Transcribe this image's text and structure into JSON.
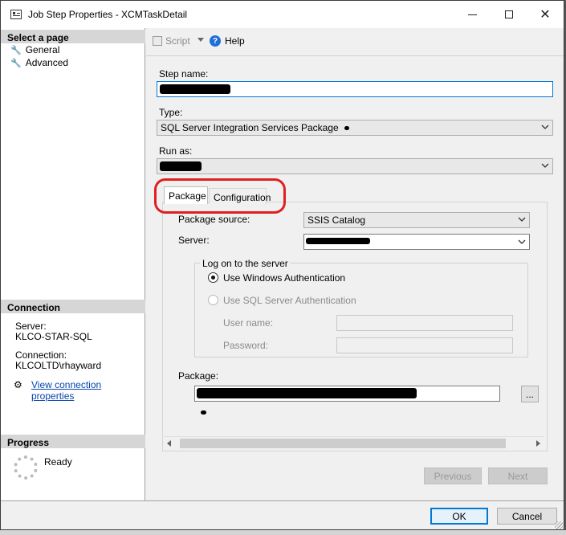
{
  "window": {
    "title": "Job Step Properties - XCMTaskDetail"
  },
  "sidebar": {
    "select_page_header": "Select a page",
    "pages": [
      {
        "label": "General"
      },
      {
        "label": "Advanced"
      }
    ],
    "connection_header": "Connection",
    "server_label": "Server:",
    "server_value": "KLCO-STAR-SQL",
    "connection_label": "Connection:",
    "connection_value": "KLCOLTD\\rhayward",
    "view_connection_link": "View connection properties",
    "progress_header": "Progress",
    "progress_status": "Ready"
  },
  "toolbar": {
    "script_label": "Script",
    "help_label": "Help"
  },
  "form": {
    "step_name_label": "Step name:",
    "type_label": "Type:",
    "type_value": "SQL Server Integration Services Package",
    "run_as_label": "Run as:"
  },
  "tabs": [
    {
      "label": "Package"
    },
    {
      "label": "Configuration"
    }
  ],
  "package_tab": {
    "source_label": "Package source:",
    "source_value": "SSIS Catalog",
    "server_label": "Server:",
    "logon_group_label": "Log on to the server",
    "windows_auth_label": "Use Windows Authentication",
    "sql_auth_label": "Use SQL Server Authentication",
    "user_name_label": "User name:",
    "password_label": "Password:",
    "package_label": "Package:",
    "browse_label": "..."
  },
  "nav": {
    "previous_label": "Previous",
    "next_label": "Next"
  },
  "footer": {
    "ok_label": "OK",
    "cancel_label": "Cancel"
  },
  "colors": {
    "highlight_circle": "#e02020",
    "focus_border": "#0078d7",
    "link": "#0645ad"
  }
}
